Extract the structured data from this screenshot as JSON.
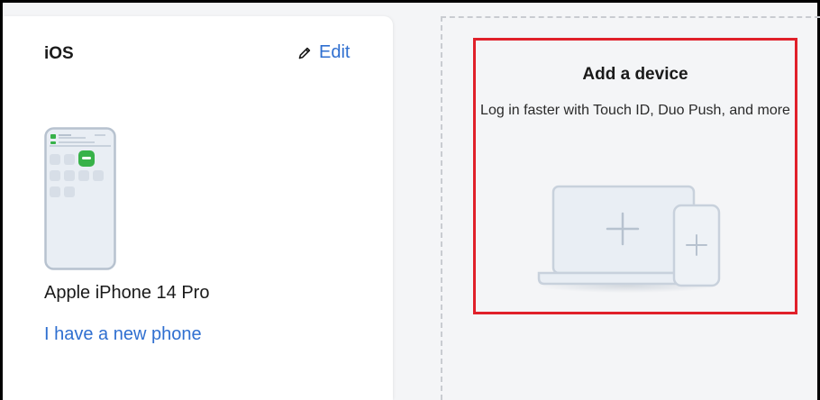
{
  "device_card": {
    "os_label": "iOS",
    "edit_label": "Edit",
    "model_name": "Apple iPhone 14 Pro",
    "new_phone_link": "I have a new phone",
    "icons": [
      "pencil-icon",
      "phone-thumbnail",
      "push-notification-badge-icon"
    ]
  },
  "add_device": {
    "title": "Add a device",
    "description": "Log in faster with Touch ID, Duo Push, and more",
    "icons": [
      "laptop-plus-icon",
      "phone-plus-icon"
    ]
  },
  "colors": {
    "link": "#2f6fd0",
    "highlight_border": "#e0202a",
    "notification_badge": "#38b249",
    "dashed_border": "#c9ccd1",
    "illustration_fill": "#e9eef4",
    "illustration_stroke": "#c8d1dc"
  }
}
